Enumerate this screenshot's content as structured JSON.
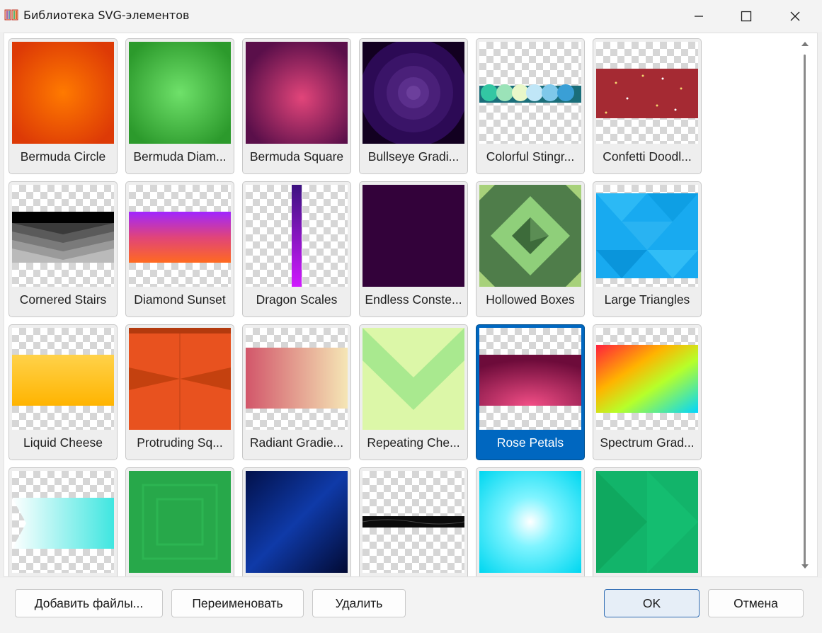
{
  "window": {
    "title": "Библиотека SVG-элементов",
    "app_icon": "book-icon",
    "controls": [
      "minimize-icon",
      "maximize-icon",
      "close-icon"
    ]
  },
  "library": {
    "selected": "Rose Petals",
    "items": [
      {
        "label": "Bermuda Circle",
        "thumbnail": "bermuda-circle"
      },
      {
        "label": "Bermuda Diam...",
        "thumbnail": "bermuda-diamond"
      },
      {
        "label": "Bermuda Square",
        "thumbnail": "bermuda-square"
      },
      {
        "label": "Bullseye Gradi...",
        "thumbnail": "bullseye-gradient"
      },
      {
        "label": "Colorful Stingr...",
        "thumbnail": "colorful-stingrays"
      },
      {
        "label": "Confetti Doodl...",
        "thumbnail": "confetti-doodles"
      },
      {
        "label": "Cornered Stairs",
        "thumbnail": "cornered-stairs"
      },
      {
        "label": "Diamond Sunset",
        "thumbnail": "diamond-sunset"
      },
      {
        "label": "Dragon Scales",
        "thumbnail": "dragon-scales"
      },
      {
        "label": "Endless Conste...",
        "thumbnail": "endless-constellation"
      },
      {
        "label": "Hollowed Boxes",
        "thumbnail": "hollowed-boxes"
      },
      {
        "label": "Large Triangles",
        "thumbnail": "large-triangles"
      },
      {
        "label": "Liquid Cheese",
        "thumbnail": "liquid-cheese"
      },
      {
        "label": "Protruding Sq...",
        "thumbnail": "protruding-squares"
      },
      {
        "label": "Radiant Gradie...",
        "thumbnail": "radiant-gradient"
      },
      {
        "label": "Repeating Che...",
        "thumbnail": "repeating-chevrons"
      },
      {
        "label": "Rose Petals",
        "thumbnail": "rose-petals"
      },
      {
        "label": "Spectrum Grad...",
        "thumbnail": "spectrum-gradient"
      },
      {
        "label": "",
        "thumbnail": "cyan-triangles"
      },
      {
        "label": "",
        "thumbnail": "green-maze"
      },
      {
        "label": "",
        "thumbnail": "navy-stripes"
      },
      {
        "label": "",
        "thumbnail": "wavy-black"
      },
      {
        "label": "",
        "thumbnail": "cyan-sunburst"
      },
      {
        "label": "",
        "thumbnail": "green-chevron"
      }
    ]
  },
  "scrollbar": {
    "up": "scroll-up-icon",
    "down": "scroll-down-icon"
  },
  "buttons": {
    "add_files": "Добавить файлы...",
    "rename": "Переименовать",
    "delete": "Удалить",
    "ok": "OK",
    "cancel": "Отмена"
  },
  "colors": {
    "selection": "#0067c0",
    "ok_border": "#2f6cb3"
  }
}
